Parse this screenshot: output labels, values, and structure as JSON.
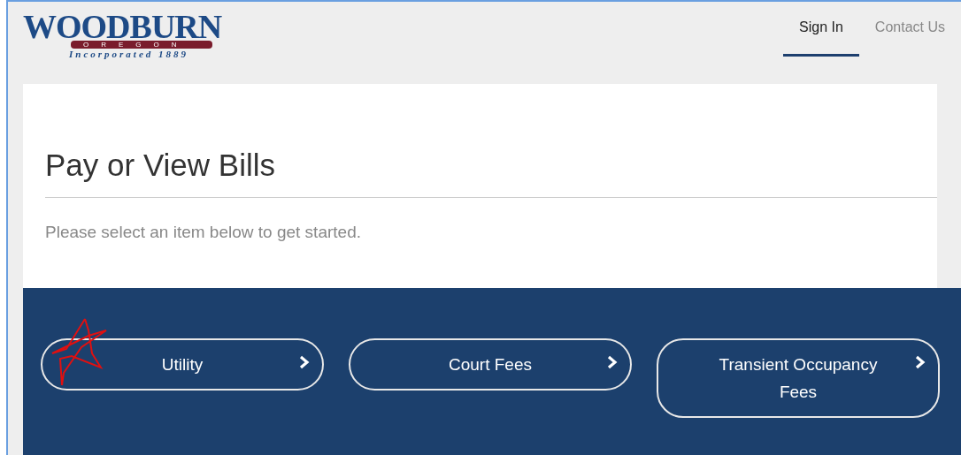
{
  "logo": {
    "name": "WOODBURN",
    "state": "OREGON",
    "tagline": "Incorporated 1889"
  },
  "nav": [
    {
      "label": "Sign In",
      "selected": true
    },
    {
      "label": "Contact Us",
      "selected": false
    }
  ],
  "heading": "Pay or View Bills",
  "intro": "Please select an item below to get started.",
  "options": [
    {
      "label": "Utility",
      "marked": true
    },
    {
      "label": "Court Fees",
      "marked": false
    },
    {
      "label": "Transient Occupancy Fees",
      "marked": false
    }
  ]
}
